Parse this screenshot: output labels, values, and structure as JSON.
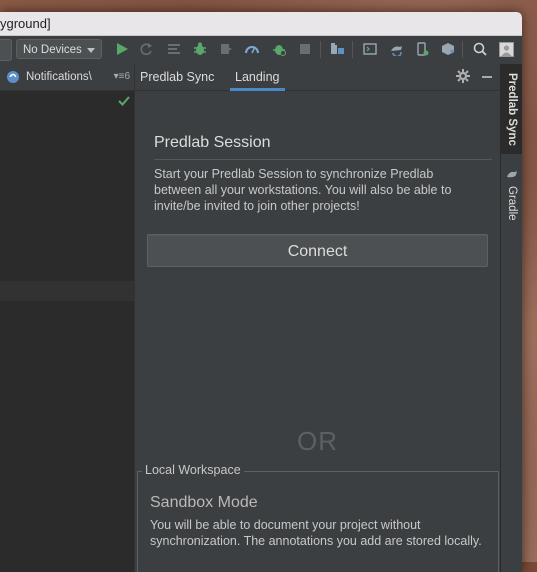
{
  "window": {
    "title_fragment": "yground]"
  },
  "toolbar": {
    "device_selector": "No Devices",
    "icons": [
      "run-icon",
      "apply-changes-icon",
      "coverage-icon",
      "debug-icon",
      "attach-debugger-icon",
      "profile-icon",
      "attach-profiler-icon",
      "stop-icon",
      "project-structure-icon",
      "terminal-icon",
      "sync-gradle-icon",
      "device-manager-icon",
      "sdk-manager-icon",
      "search-icon",
      "user-avatar-icon"
    ],
    "colors": {
      "run": "#59a869",
      "debug": "#59a869",
      "disabled": "#6b6e70"
    }
  },
  "left_panel": {
    "header_label": "Notifications\\",
    "options_glyph": "▾≡",
    "options_count": "6",
    "status_icon": "check-icon"
  },
  "tool_window": {
    "tabs": [
      {
        "label": "Predlab Sync",
        "active": false
      },
      {
        "label": "Landing",
        "active": true
      }
    ],
    "session": {
      "title": "Predlab Session",
      "description": "Start your Predlab Session to synchronize Predlab between all your workstations. You will also be able to invite/be invited to join other projects!",
      "connect_label": "Connect"
    },
    "or_label": "OR",
    "local_workspace": {
      "legend": "Local Workspace",
      "title": "Sandbox Mode",
      "description": "You will be able to document your project without synchronization. The annotations you add are stored locally."
    }
  },
  "right_strip": {
    "tabs": [
      {
        "label": "Predlab Sync",
        "active": true
      },
      {
        "label": "Gradle",
        "active": false
      }
    ]
  }
}
